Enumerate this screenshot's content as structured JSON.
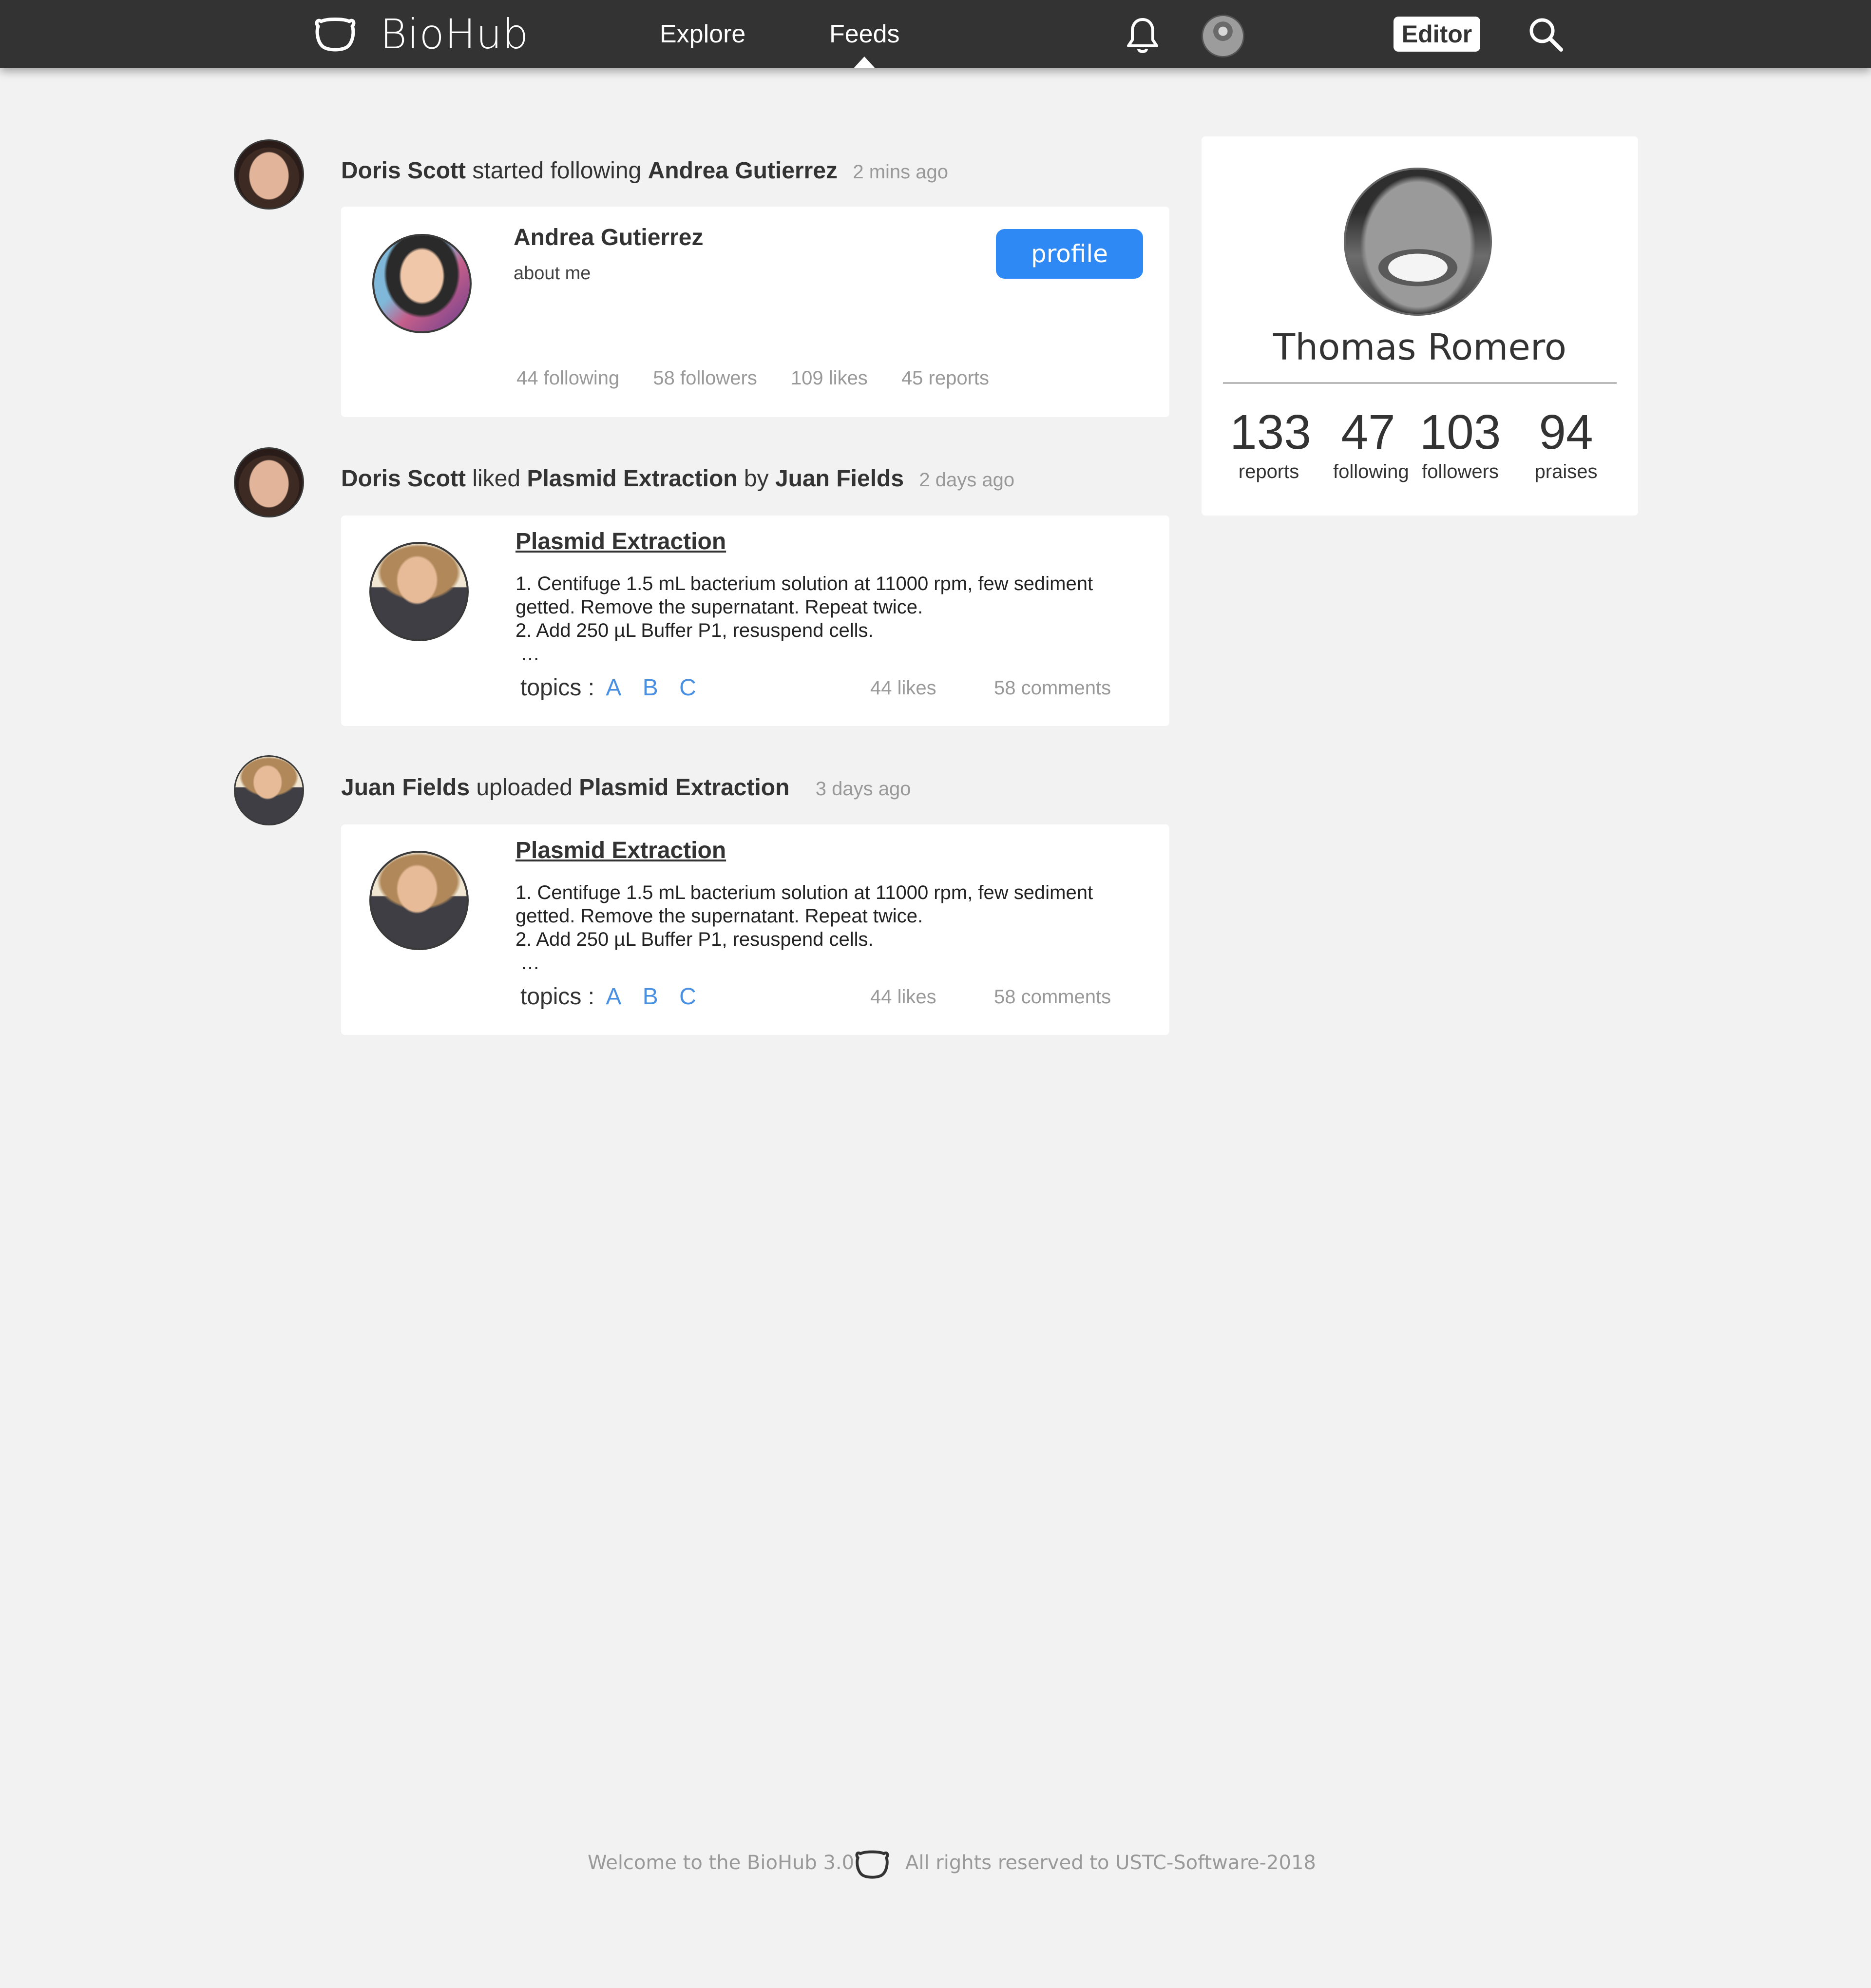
{
  "nav": {
    "brand": "BioHub",
    "links": [
      "Explore",
      "Feeds"
    ],
    "active": "Feeds",
    "editor_label": "Editor"
  },
  "sidebar": {
    "name": "Thomas Romero",
    "stats": [
      {
        "value": "133",
        "label": "reports"
      },
      {
        "value": "47",
        "label": "following"
      },
      {
        "value": "103",
        "label": "followers"
      },
      {
        "value": "94",
        "label": "praises"
      }
    ]
  },
  "feed": [
    {
      "actor": "Doris Scott",
      "action": "started following",
      "target": "Andrea Gutierrez",
      "time": "2 mins ago",
      "card": {
        "name": "Andrea Gutierrez",
        "about": "about me",
        "button": "profile",
        "stats": [
          "44 following",
          "58 followers",
          "109 likes",
          "45 reports"
        ]
      }
    },
    {
      "actor": "Doris Scott",
      "action": "liked",
      "target": "Plasmid Extraction",
      "by": "by",
      "target_author": "Juan Fields",
      "time": "2 days ago",
      "card": {
        "title": "Plasmid Extraction",
        "lines": [
          "1. Centifuge 1.5 mL bacterium solution at 11000 rpm, few sediment",
          "getted. Remove the supernatant. Repeat twice.",
          "2. Add 250 µL Buffer P1, resuspend cells.",
          "…"
        ],
        "topics_label": "topics :",
        "topics": [
          "A",
          "B",
          "C"
        ],
        "likes": "44 likes",
        "comments": "58 comments"
      }
    },
    {
      "actor": "Juan Fields",
      "action": "uploaded",
      "target": "Plasmid Extraction",
      "time": "3 days ago",
      "card": {
        "title": "Plasmid Extraction",
        "lines": [
          "1. Centifuge 1.5 mL bacterium solution at 11000 rpm, few sediment",
          "getted. Remove the supernatant. Repeat twice.",
          "2. Add 250 µL Buffer P1, resuspend cells.",
          "…"
        ],
        "topics_label": "topics :",
        "topics": [
          "A",
          "B",
          "C"
        ],
        "likes": "44 likes",
        "comments": "58 comments"
      }
    }
  ],
  "footer": {
    "left": "Welcome to the BioHub 3.0.",
    "right": "All rights reserved to USTC-Software-2018"
  },
  "colors": {
    "navbar": "#333333",
    "background": "#f2f2f2",
    "accent_button": "#2e89f5",
    "topic_link": "#4a90e2",
    "muted_text": "#999999"
  },
  "icons": [
    "biohub-logo-icon",
    "bell-icon",
    "user-avatar",
    "search-icon"
  ]
}
